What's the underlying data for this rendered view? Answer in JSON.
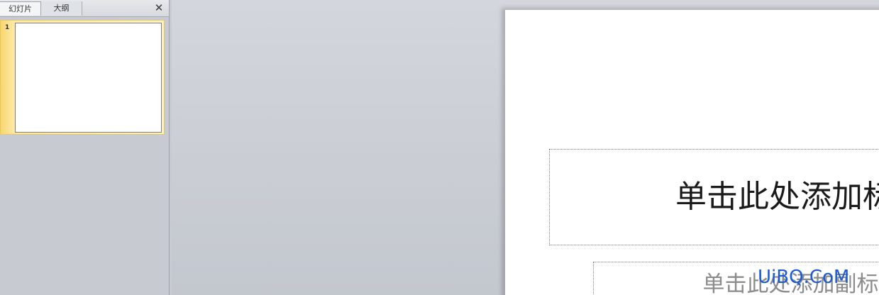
{
  "slides_pane": {
    "tabs": [
      {
        "label": "幻灯片"
      },
      {
        "label": "大纲"
      }
    ],
    "close_icon": "close-icon",
    "thumbnails": [
      {
        "number": "1"
      }
    ]
  },
  "slide": {
    "title_placeholder": "单击此处添加标题",
    "subtitle_placeholder": "单击此处添加副标题"
  },
  "watermark": "UiBQ.CoM",
  "colors": {
    "selection": "#fde9a6",
    "pane_background": "#c7cbd1",
    "watermark": "#1c5bd6"
  }
}
